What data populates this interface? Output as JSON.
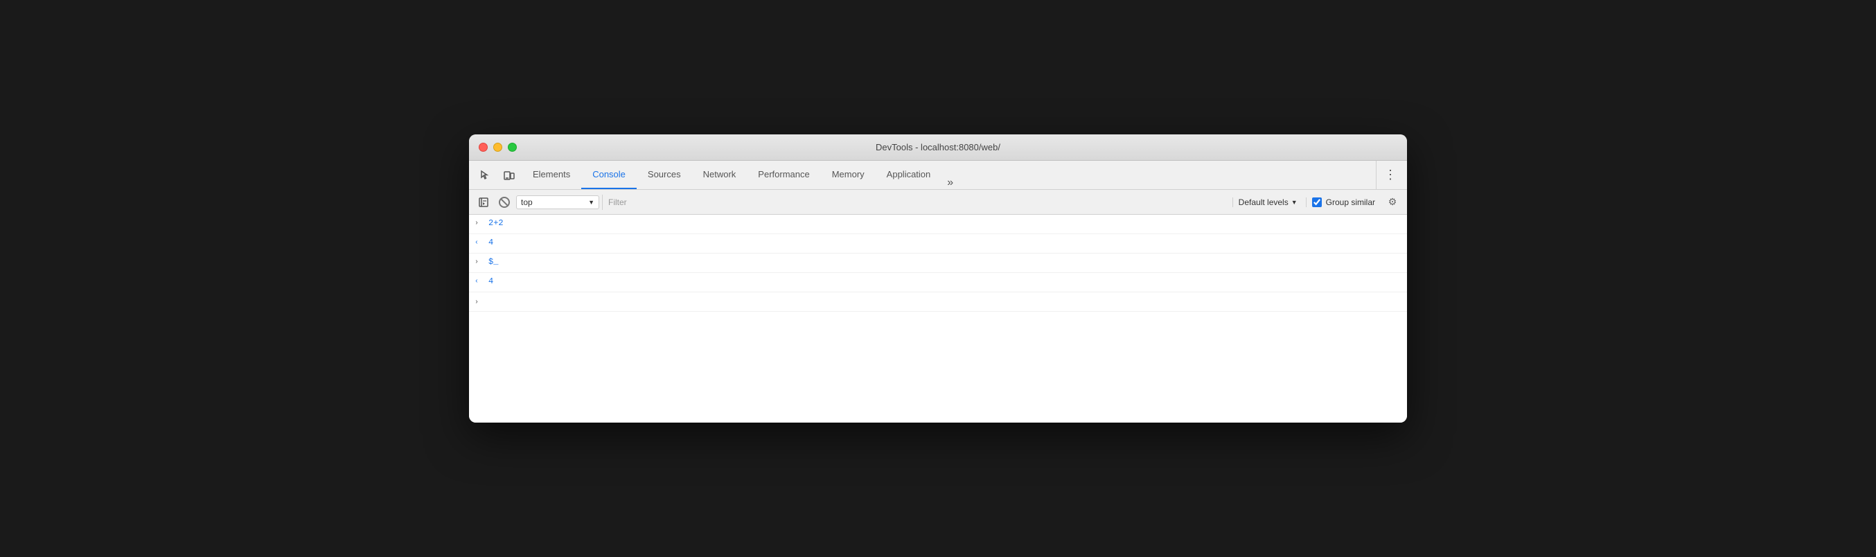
{
  "window": {
    "title": "DevTools - localhost:8080/web/"
  },
  "toolbar": {
    "tabs": [
      {
        "id": "elements",
        "label": "Elements",
        "active": false
      },
      {
        "id": "console",
        "label": "Console",
        "active": true
      },
      {
        "id": "sources",
        "label": "Sources",
        "active": false
      },
      {
        "id": "network",
        "label": "Network",
        "active": false
      },
      {
        "id": "performance",
        "label": "Performance",
        "active": false
      },
      {
        "id": "memory",
        "label": "Memory",
        "active": false
      },
      {
        "id": "application",
        "label": "Application",
        "active": false
      }
    ],
    "more_label": "»"
  },
  "console_toolbar": {
    "context_label": "top",
    "filter_placeholder": "Filter",
    "default_levels_label": "Default levels",
    "group_similar_label": "Group similar"
  },
  "console_output": [
    {
      "type": "input",
      "text": "2+2"
    },
    {
      "type": "output",
      "text": "4"
    },
    {
      "type": "input",
      "text": "$_"
    },
    {
      "type": "output",
      "text": "4"
    }
  ]
}
